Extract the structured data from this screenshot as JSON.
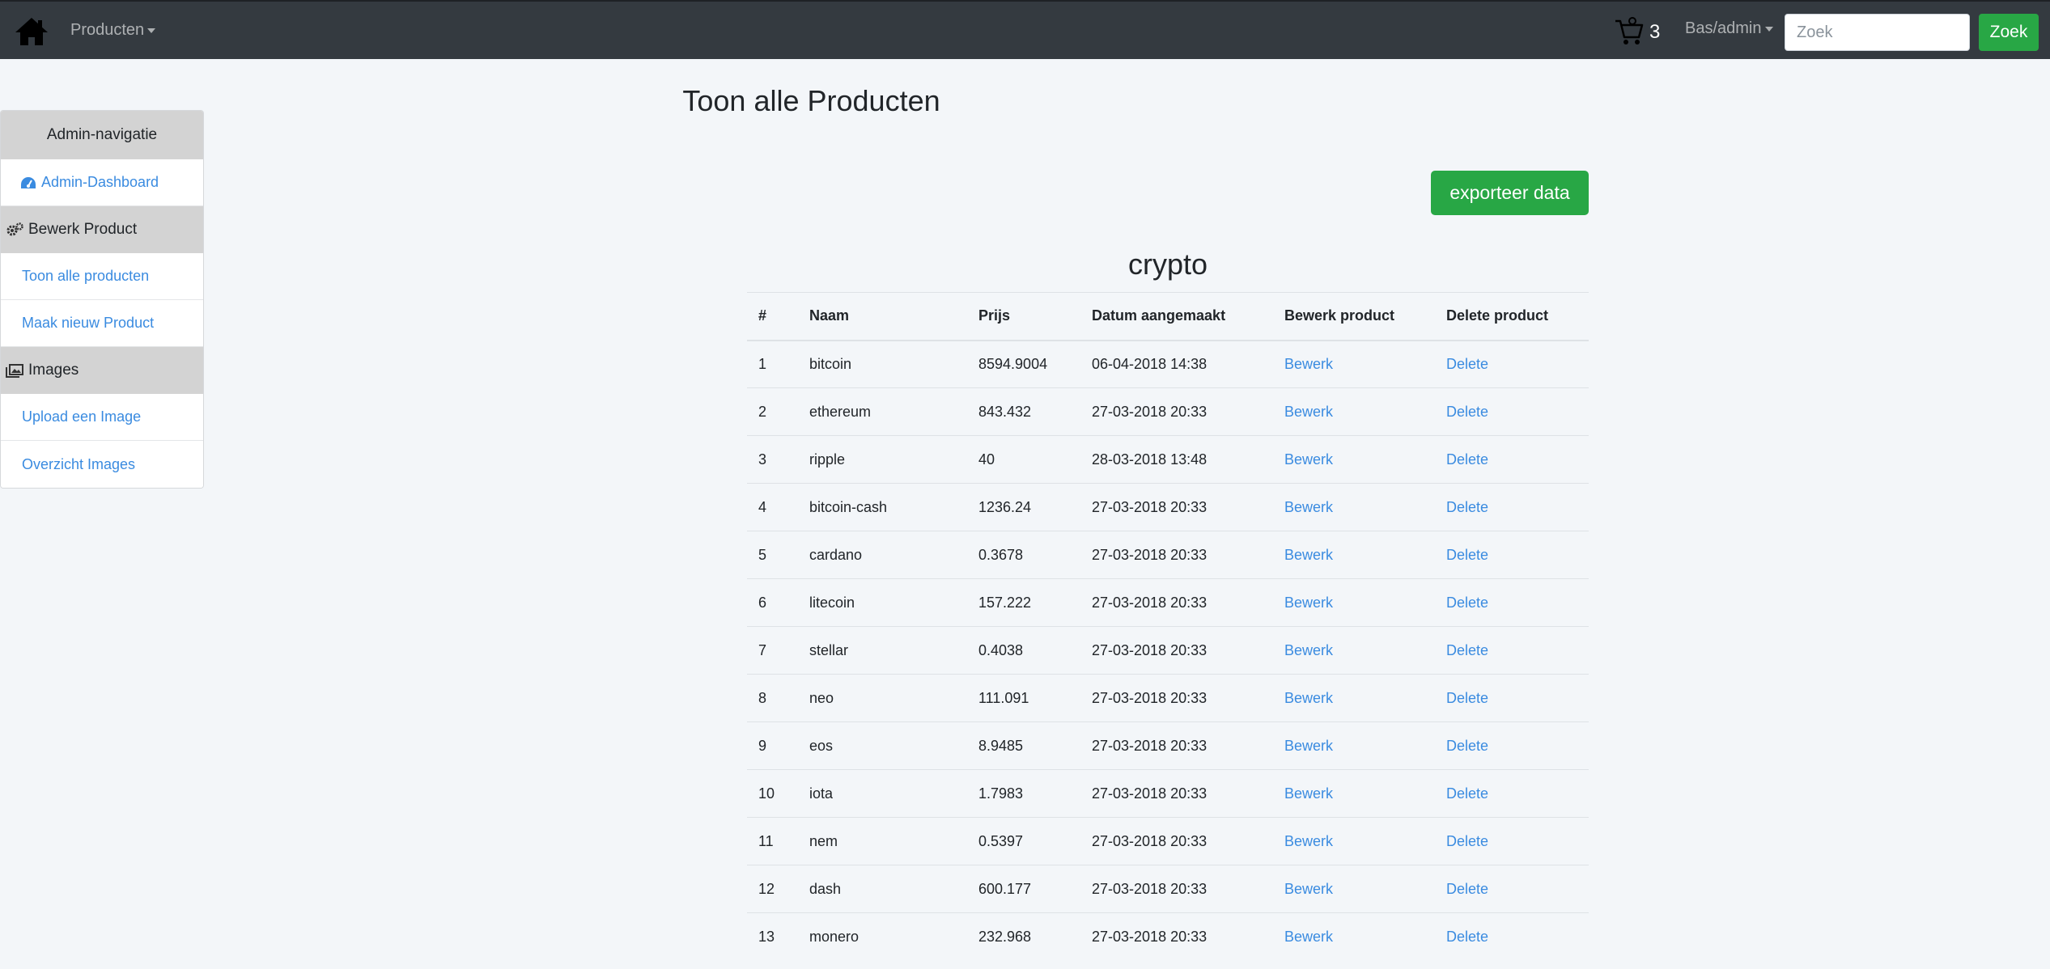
{
  "navbar": {
    "producten_label": "Producten",
    "cart_count": "3",
    "user_label": "Bas/admin",
    "search_placeholder": "Zoek",
    "search_button": "Zoek"
  },
  "sidebar": {
    "header": "Admin-navigatie",
    "dashboard_link": "Admin-Dashboard",
    "sections": [
      {
        "title": "Bewerk Product",
        "icon": "gears-icon",
        "links": [
          "Toon alle producten",
          "Maak nieuw Product"
        ]
      },
      {
        "title": "Images",
        "icon": "images-icon",
        "links": [
          "Upload een Image",
          "Overzicht Images"
        ]
      }
    ]
  },
  "main": {
    "title": "Toon alle Producten",
    "export_button": "exporteer data",
    "table_title": "crypto",
    "columns": [
      "#",
      "Naam",
      "Prijs",
      "Datum aangemaakt",
      "Bewerk product",
      "Delete product"
    ],
    "rows": [
      [
        "1",
        "bitcoin",
        "8594.9004",
        "06-04-2018 14:38",
        "Bewerk",
        "Delete"
      ],
      [
        "2",
        "ethereum",
        "843.432",
        "27-03-2018 20:33",
        "Bewerk",
        "Delete"
      ],
      [
        "3",
        "ripple",
        "40",
        "28-03-2018 13:48",
        "Bewerk",
        "Delete"
      ],
      [
        "4",
        "bitcoin-cash",
        "1236.24",
        "27-03-2018 20:33",
        "Bewerk",
        "Delete"
      ],
      [
        "5",
        "cardano",
        "0.3678",
        "27-03-2018 20:33",
        "Bewerk",
        "Delete"
      ],
      [
        "6",
        "litecoin",
        "157.222",
        "27-03-2018 20:33",
        "Bewerk",
        "Delete"
      ],
      [
        "7",
        "stellar",
        "0.4038",
        "27-03-2018 20:33",
        "Bewerk",
        "Delete"
      ],
      [
        "8",
        "neo",
        "111.091",
        "27-03-2018 20:33",
        "Bewerk",
        "Delete"
      ],
      [
        "9",
        "eos",
        "8.9485",
        "27-03-2018 20:33",
        "Bewerk",
        "Delete"
      ],
      [
        "10",
        "iota",
        "1.7983",
        "27-03-2018 20:33",
        "Bewerk",
        "Delete"
      ],
      [
        "11",
        "nem",
        "0.5397",
        "27-03-2018 20:33",
        "Bewerk",
        "Delete"
      ],
      [
        "12",
        "dash",
        "600.177",
        "27-03-2018 20:33",
        "Bewerk",
        "Delete"
      ],
      [
        "13",
        "monero",
        "232.968",
        "27-03-2018 20:33",
        "Bewerk",
        "Delete"
      ]
    ]
  },
  "colors": {
    "navbar": "#343a40",
    "success": "#28a745",
    "link": "#3a8be0",
    "sidebar_header": "#d3d3d3"
  }
}
